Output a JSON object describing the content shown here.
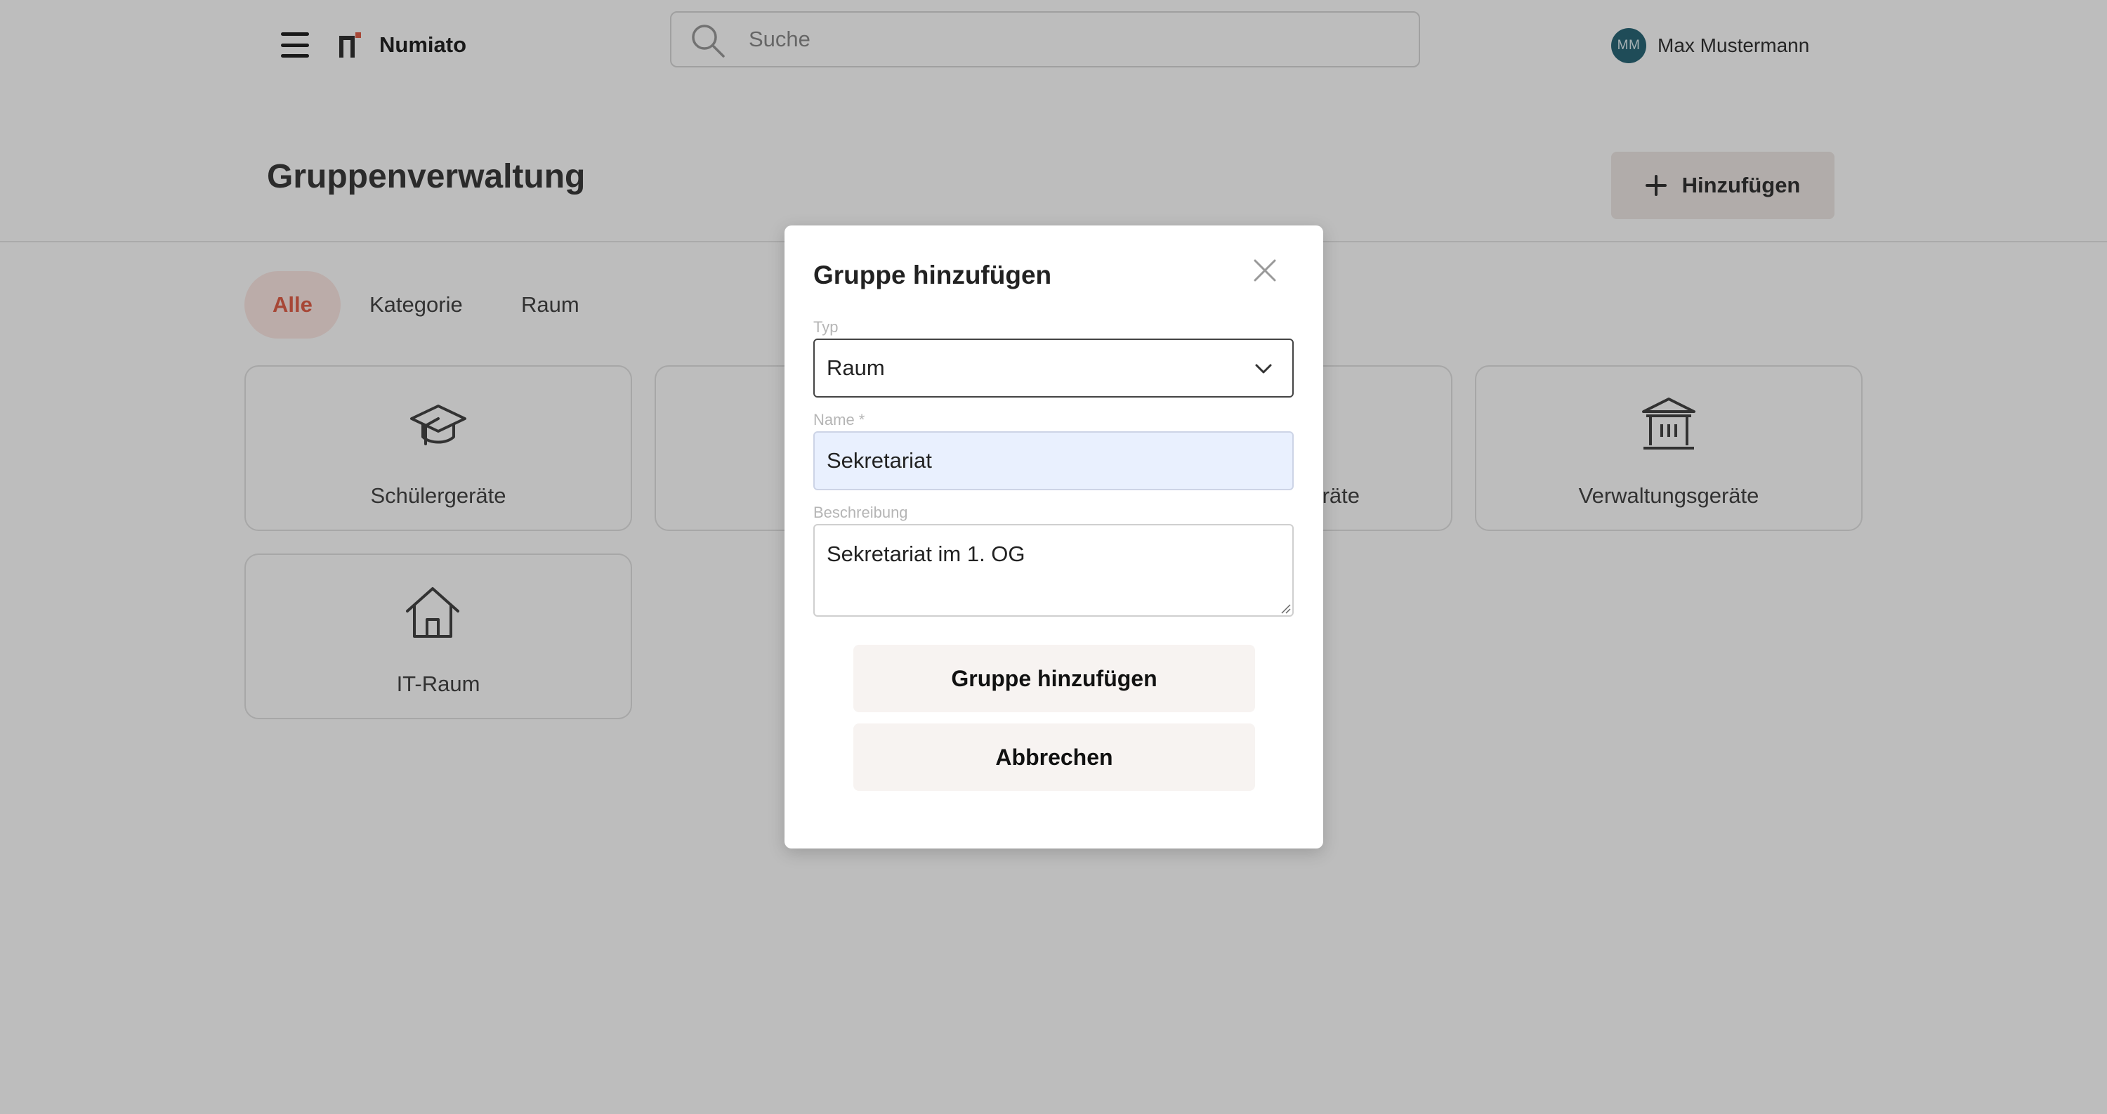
{
  "header": {
    "brand": "Numiato",
    "search_placeholder": "Suche",
    "user_initials": "MM",
    "user_name": "Max Mustermann"
  },
  "page": {
    "title": "Gruppenverwaltung",
    "add_label": "Hinzufügen"
  },
  "tabs": [
    {
      "label": "Alle",
      "active": true
    },
    {
      "label": "Kategorie",
      "active": false
    },
    {
      "label": "Raum",
      "active": false
    }
  ],
  "cards": [
    {
      "label": "Schülergeräte",
      "icon": "graduation-cap-icon"
    },
    {
      "label": "",
      "icon": ""
    },
    {
      "label": "räte",
      "icon": ""
    },
    {
      "label": "Verwaltungsgeräte",
      "icon": "building-icon"
    },
    {
      "label": "IT-Raum",
      "icon": "house-icon"
    }
  ],
  "modal": {
    "title": "Gruppe hinzufügen",
    "type_label": "Typ",
    "type_value": "Raum",
    "name_label": "Name *",
    "name_value": "Sekretariat",
    "description_label": "Beschreibung",
    "description_value": "Sekretariat im 1. OG",
    "submit_label": "Gruppe hinzufügen",
    "cancel_label": "Abbrechen"
  },
  "colors": {
    "accent": "#e2604a",
    "avatar": "#2b6777",
    "autofill": "#e9f0fe"
  }
}
